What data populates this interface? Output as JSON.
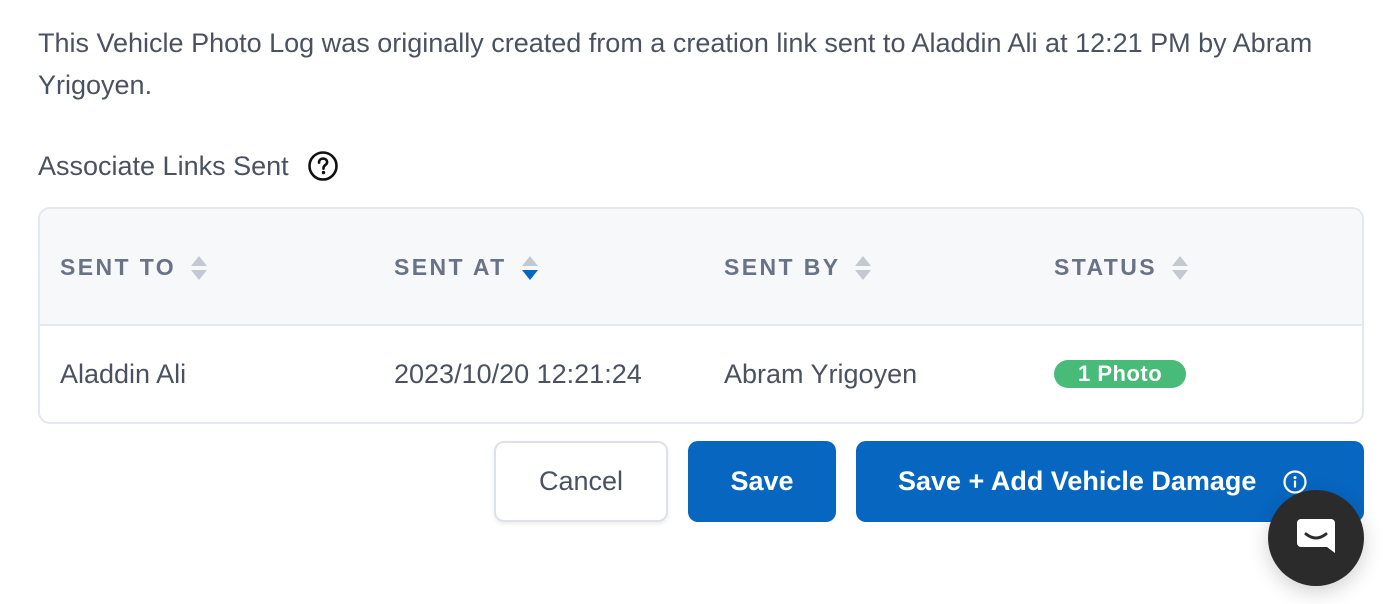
{
  "intro_text": "This Vehicle Photo Log was originally created from a creation link sent to Aladdin Ali at 12:21 PM by Abram Yrigoyen.",
  "section": {
    "title": "Associate Links Sent",
    "help_icon": "question-circle-icon"
  },
  "table": {
    "columns": [
      {
        "label": "SENT TO",
        "sort": "none"
      },
      {
        "label": "SENT AT",
        "sort": "descending"
      },
      {
        "label": "SENT BY",
        "sort": "none"
      },
      {
        "label": "STATUS",
        "sort": "none"
      }
    ],
    "rows": [
      {
        "sent_to": "Aladdin Ali",
        "sent_at": "2023/10/20 12:21:24",
        "sent_by": "Abram Yrigoyen",
        "status": "1 Photo"
      }
    ]
  },
  "actions": {
    "cancel_label": "Cancel",
    "save_label": "Save",
    "save_damage_label": "Save + Add Vehicle Damage",
    "save_damage_icon": "info-circle-icon"
  },
  "chat": {
    "icon": "chat-bubble-icon"
  },
  "colors": {
    "primary": "#0766c0",
    "badge_success": "#48bb78",
    "sort_active": "#0766c0",
    "sort_inactive": "#c3c9d2",
    "text": "#4a5261",
    "header_bg": "#f7f8fa"
  }
}
